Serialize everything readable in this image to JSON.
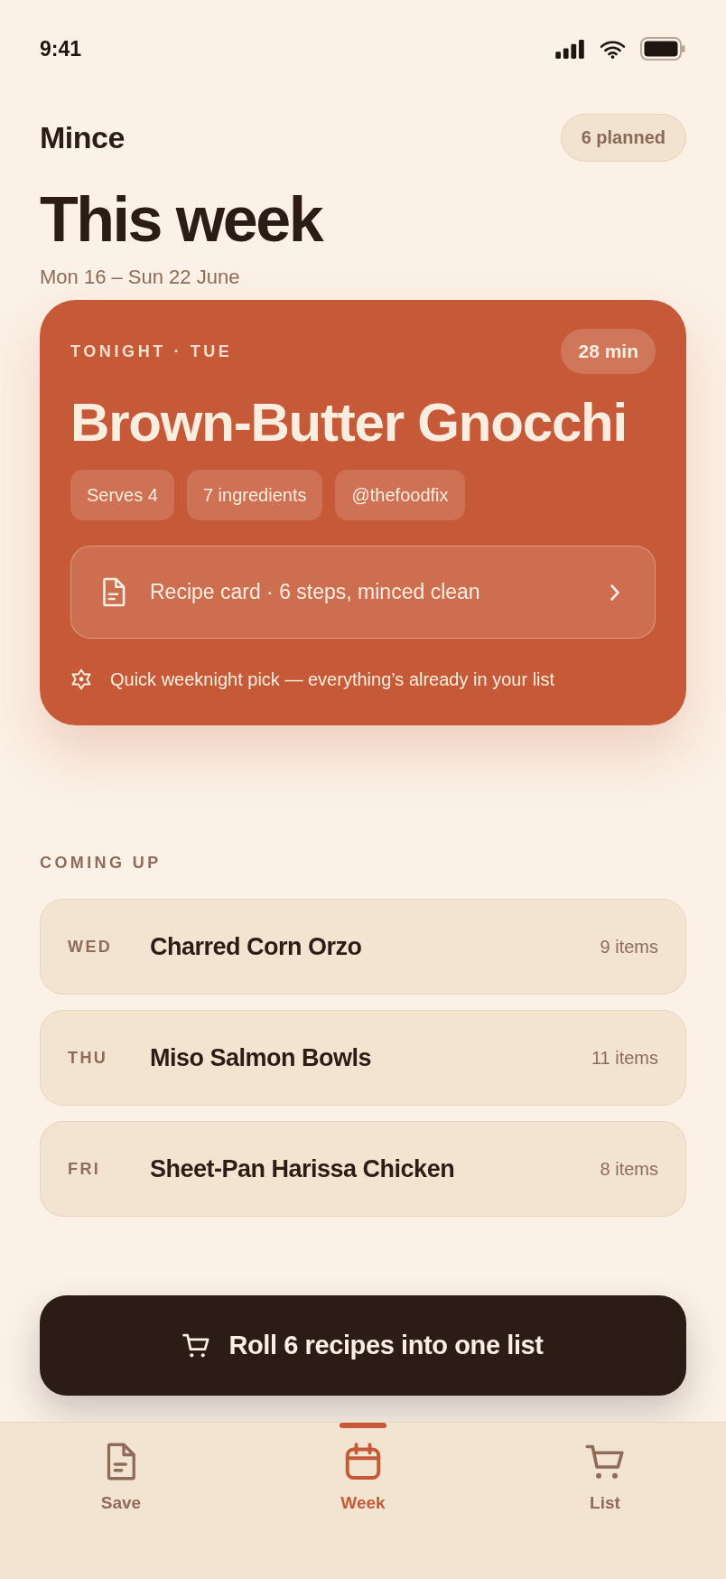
{
  "status_bar": {
    "time": "9:41"
  },
  "header": {
    "app_name": "Mince",
    "planned_badge": "6 planned",
    "title": "This week",
    "date_range": "Mon 16 – Sun 22 June"
  },
  "tonight": {
    "eyebrow": "TONIGHT · TUE",
    "time": "28 min",
    "title": "Brown-Butter Gnocchi",
    "chips": [
      "Serves 4",
      "7 ingredients",
      "@thefoodfix"
    ],
    "recipe_card": "Recipe card · 6 steps, minced clean",
    "note": "Quick weeknight pick — everything’s already in your list"
  },
  "coming_up": {
    "heading": "COMING UP",
    "meals": [
      {
        "day": "WED",
        "title": "Charred Corn Orzo",
        "count": "9 items"
      },
      {
        "day": "THU",
        "title": "Miso Salmon Bowls",
        "count": "11 items"
      },
      {
        "day": "FRI",
        "title": "Sheet-Pan Harissa Chicken",
        "count": "8 items"
      }
    ]
  },
  "cta": {
    "label": "Roll 6 recipes into one list"
  },
  "tab_bar": [
    {
      "label": "Save",
      "kind": "document",
      "selected": false
    },
    {
      "label": "Week",
      "kind": "calendar",
      "selected": true
    },
    {
      "label": "List",
      "kind": "cart",
      "selected": false
    }
  ]
}
